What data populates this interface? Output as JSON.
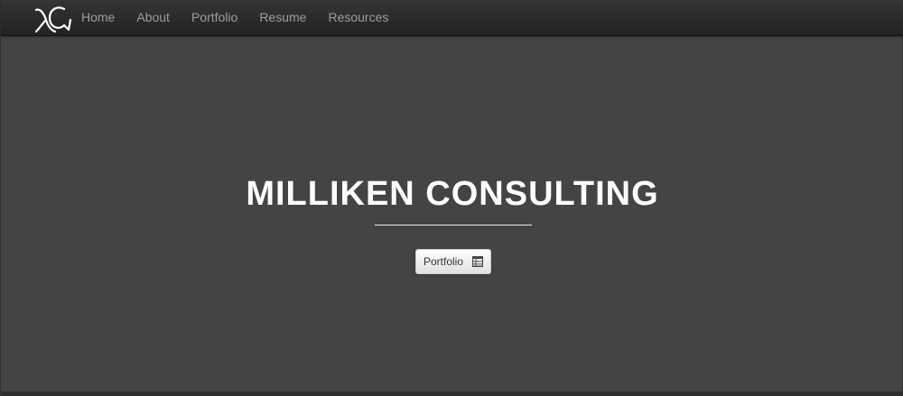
{
  "brand": {
    "logo_name": "xcg-monogram-logo"
  },
  "nav": {
    "items": [
      {
        "label": "Home"
      },
      {
        "label": "About"
      },
      {
        "label": "Portfolio"
      },
      {
        "label": "Resume"
      },
      {
        "label": "Resources"
      }
    ]
  },
  "hero": {
    "title": "MILLIKEN CONSULTING",
    "button_label": "Portfolio",
    "button_icon": "table-icon"
  },
  "colors": {
    "navbar": "#222222",
    "background": "#444444",
    "nav_text": "#9d9d9d",
    "title": "#ffffff"
  }
}
